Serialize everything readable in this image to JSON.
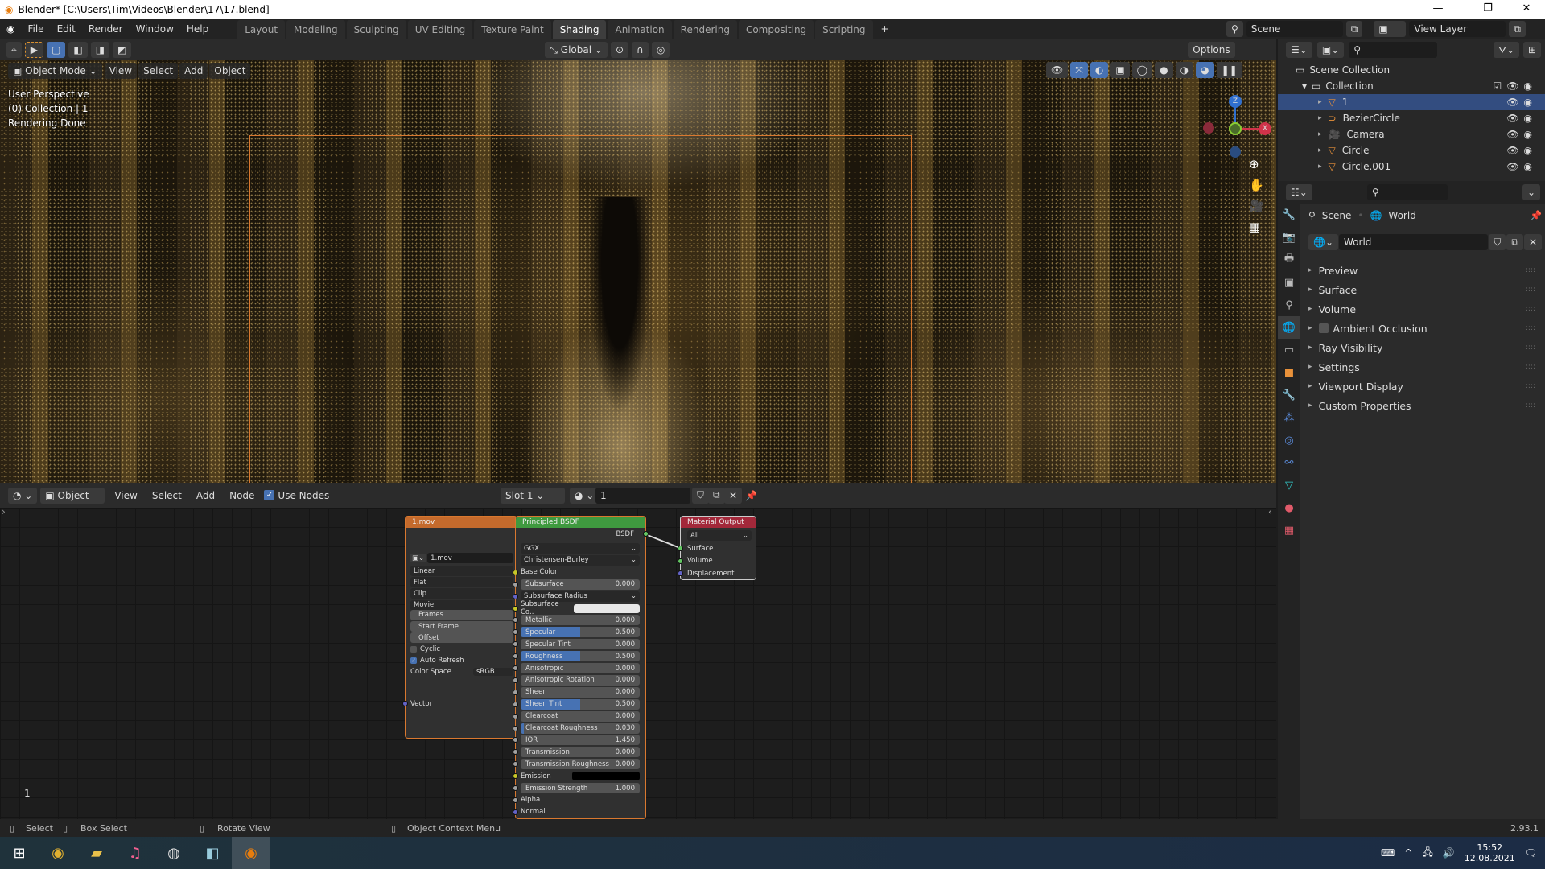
{
  "window": {
    "title": "Blender* [C:\\Users\\Tim\\Videos\\Blender\\17\\17.blend]",
    "minimize": "—",
    "restore": "❐",
    "close": "✕"
  },
  "menu": [
    "File",
    "Edit",
    "Render",
    "Window",
    "Help"
  ],
  "workspaces": [
    {
      "label": "Layout"
    },
    {
      "label": "Modeling"
    },
    {
      "label": "Sculpting"
    },
    {
      "label": "UV Editing"
    },
    {
      "label": "Texture Paint"
    },
    {
      "label": "Shading",
      "active": true
    },
    {
      "label": "Animation"
    },
    {
      "label": "Rendering"
    },
    {
      "label": "Compositing"
    },
    {
      "label": "Scripting"
    }
  ],
  "add_workspace": "+",
  "scene": {
    "label": "Scene",
    "view_layer": "View Layer"
  },
  "toolrow": {
    "orientation": "Global",
    "options": "Options"
  },
  "viewport": {
    "mode": "Object Mode",
    "menus": [
      "View",
      "Select",
      "Add",
      "Object"
    ],
    "overlay": [
      "User Perspective",
      "(0) Collection | 1",
      "Rendering Done"
    ],
    "gizmo": {
      "z": "Z",
      "x": "X",
      "y": "Y"
    }
  },
  "node_editor": {
    "type": "Object",
    "menus": [
      "View",
      "Select",
      "Add",
      "Node"
    ],
    "use_nodes": "Use Nodes",
    "use_nodes_checked": true,
    "slot": "Slot 1",
    "material": "1",
    "frame": "1"
  },
  "nodes": {
    "movie": {
      "title": "1.mov",
      "image": "1.mov",
      "rows": [
        {
          "label": "Linear",
          "type": "dd"
        },
        {
          "label": "Flat",
          "type": "dd"
        },
        {
          "label": "Clip",
          "type": "dd"
        },
        {
          "label": "Movie",
          "type": "dd"
        },
        {
          "label": "Frames",
          "type": "field"
        },
        {
          "label": "Start Frame",
          "type": "field"
        },
        {
          "label": "Offset",
          "type": "field"
        },
        {
          "label": "Cyclic",
          "type": "check",
          "checked": false
        },
        {
          "label": "Auto Refresh",
          "type": "check",
          "checked": true
        },
        {
          "label": "Color Space",
          "value": "sRGB",
          "type": "cs"
        }
      ],
      "input": "Vector",
      "color": "#c46a2c"
    },
    "bsdf": {
      "title": "Principled BSDF",
      "output": "BSDF",
      "color": "#3f9a3f",
      "rows": [
        {
          "label": "GGX",
          "type": "dd"
        },
        {
          "label": "Christensen-Burley",
          "type": "dd"
        },
        {
          "label": "Base Color",
          "type": "socket",
          "sock": "color"
        },
        {
          "label": "Subsurface",
          "value": "0.000",
          "fill": 0,
          "type": "slider",
          "sock": "float"
        },
        {
          "label": "Subsurface Radius",
          "type": "dd",
          "sock": "vector"
        },
        {
          "label": "Subsurface Co..",
          "type": "color",
          "swatch": "#e8e8e8",
          "sock": "color"
        },
        {
          "label": "Metallic",
          "value": "0.000",
          "fill": 0,
          "type": "slider",
          "sock": "float"
        },
        {
          "label": "Specular",
          "value": "0.500",
          "fill": 0.5,
          "type": "slider",
          "sock": "float"
        },
        {
          "label": "Specular Tint",
          "value": "0.000",
          "fill": 0,
          "type": "slider",
          "sock": "float"
        },
        {
          "label": "Roughness",
          "value": "0.500",
          "fill": 0.5,
          "type": "slider",
          "sock": "float"
        },
        {
          "label": "Anisotropic",
          "value": "0.000",
          "fill": 0,
          "type": "slider",
          "sock": "float"
        },
        {
          "label": "Anisotropic Rotation",
          "value": "0.000",
          "fill": 0,
          "type": "slider",
          "sock": "float"
        },
        {
          "label": "Sheen",
          "value": "0.000",
          "fill": 0,
          "type": "slider",
          "sock": "float"
        },
        {
          "label": "Sheen Tint",
          "value": "0.500",
          "fill": 0.5,
          "type": "slider",
          "sock": "float"
        },
        {
          "label": "Clearcoat",
          "value": "0.000",
          "fill": 0,
          "type": "slider",
          "sock": "float"
        },
        {
          "label": "Clearcoat Roughness",
          "value": "0.030",
          "fill": 0.03,
          "type": "slider",
          "sock": "float"
        },
        {
          "label": "IOR",
          "value": "1.450",
          "fill": 0,
          "type": "slider",
          "sock": "float"
        },
        {
          "label": "Transmission",
          "value": "0.000",
          "fill": 0,
          "type": "slider",
          "sock": "float"
        },
        {
          "label": "Transmission Roughness",
          "value": "0.000",
          "fill": 0,
          "type": "slider",
          "sock": "float"
        },
        {
          "label": "Emission",
          "type": "color",
          "swatch": "#000000",
          "sock": "color"
        },
        {
          "label": "Emission Strength",
          "value": "1.000",
          "fill": 0,
          "type": "slider",
          "sock": "float"
        },
        {
          "label": "Alpha",
          "type": "socket",
          "sock": "float"
        },
        {
          "label": "Normal",
          "type": "socket",
          "sock": "vector"
        }
      ]
    },
    "output": {
      "title": "Material Output",
      "target": "All",
      "inputs": [
        "Surface",
        "Volume",
        "Displacement"
      ],
      "color": "#a3283a"
    }
  },
  "outliner": {
    "root": "Scene Collection",
    "collection": "Collection",
    "items": [
      {
        "name": "1",
        "selected": true
      },
      {
        "name": "BezierCircle"
      },
      {
        "name": "Camera"
      },
      {
        "name": "Circle"
      },
      {
        "name": "Circle.001"
      }
    ]
  },
  "properties": {
    "breadcrumb": [
      "Scene",
      "World"
    ],
    "world": "World",
    "panels": [
      "Preview",
      "Surface",
      "Volume",
      "Ambient Occlusion",
      "Ray Visibility",
      "Settings",
      "Viewport Display",
      "Custom Properties"
    ]
  },
  "status": {
    "items": [
      "Select",
      "Box Select",
      "Rotate View",
      "Object Context Menu"
    ],
    "version": "2.93.1"
  },
  "taskbar": {
    "time": "15:52",
    "date": "12.08.2021"
  },
  "colors": {
    "accent": "#4772b3",
    "selected_row": "#334d80",
    "socket_color": "#c7c729",
    "socket_float": "#a1a1a1",
    "socket_vector": "#6363c7",
    "socket_shader": "#63c763"
  }
}
